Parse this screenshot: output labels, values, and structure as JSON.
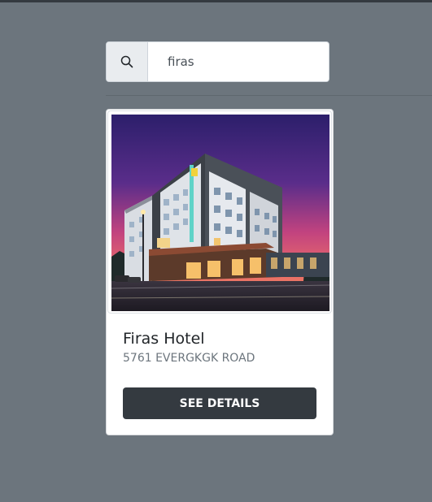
{
  "search": {
    "icon": "search-icon",
    "value": "firas",
    "placeholder": ""
  },
  "hotel": {
    "image": "hotel-photo",
    "name": "Firas Hotel",
    "address": "5761 EVERGKGK ROAD",
    "button_label": "SEE DETAILS"
  },
  "colors": {
    "page_background": "#6c757d",
    "button_background": "#343a40",
    "card_background": "#ffffff"
  }
}
